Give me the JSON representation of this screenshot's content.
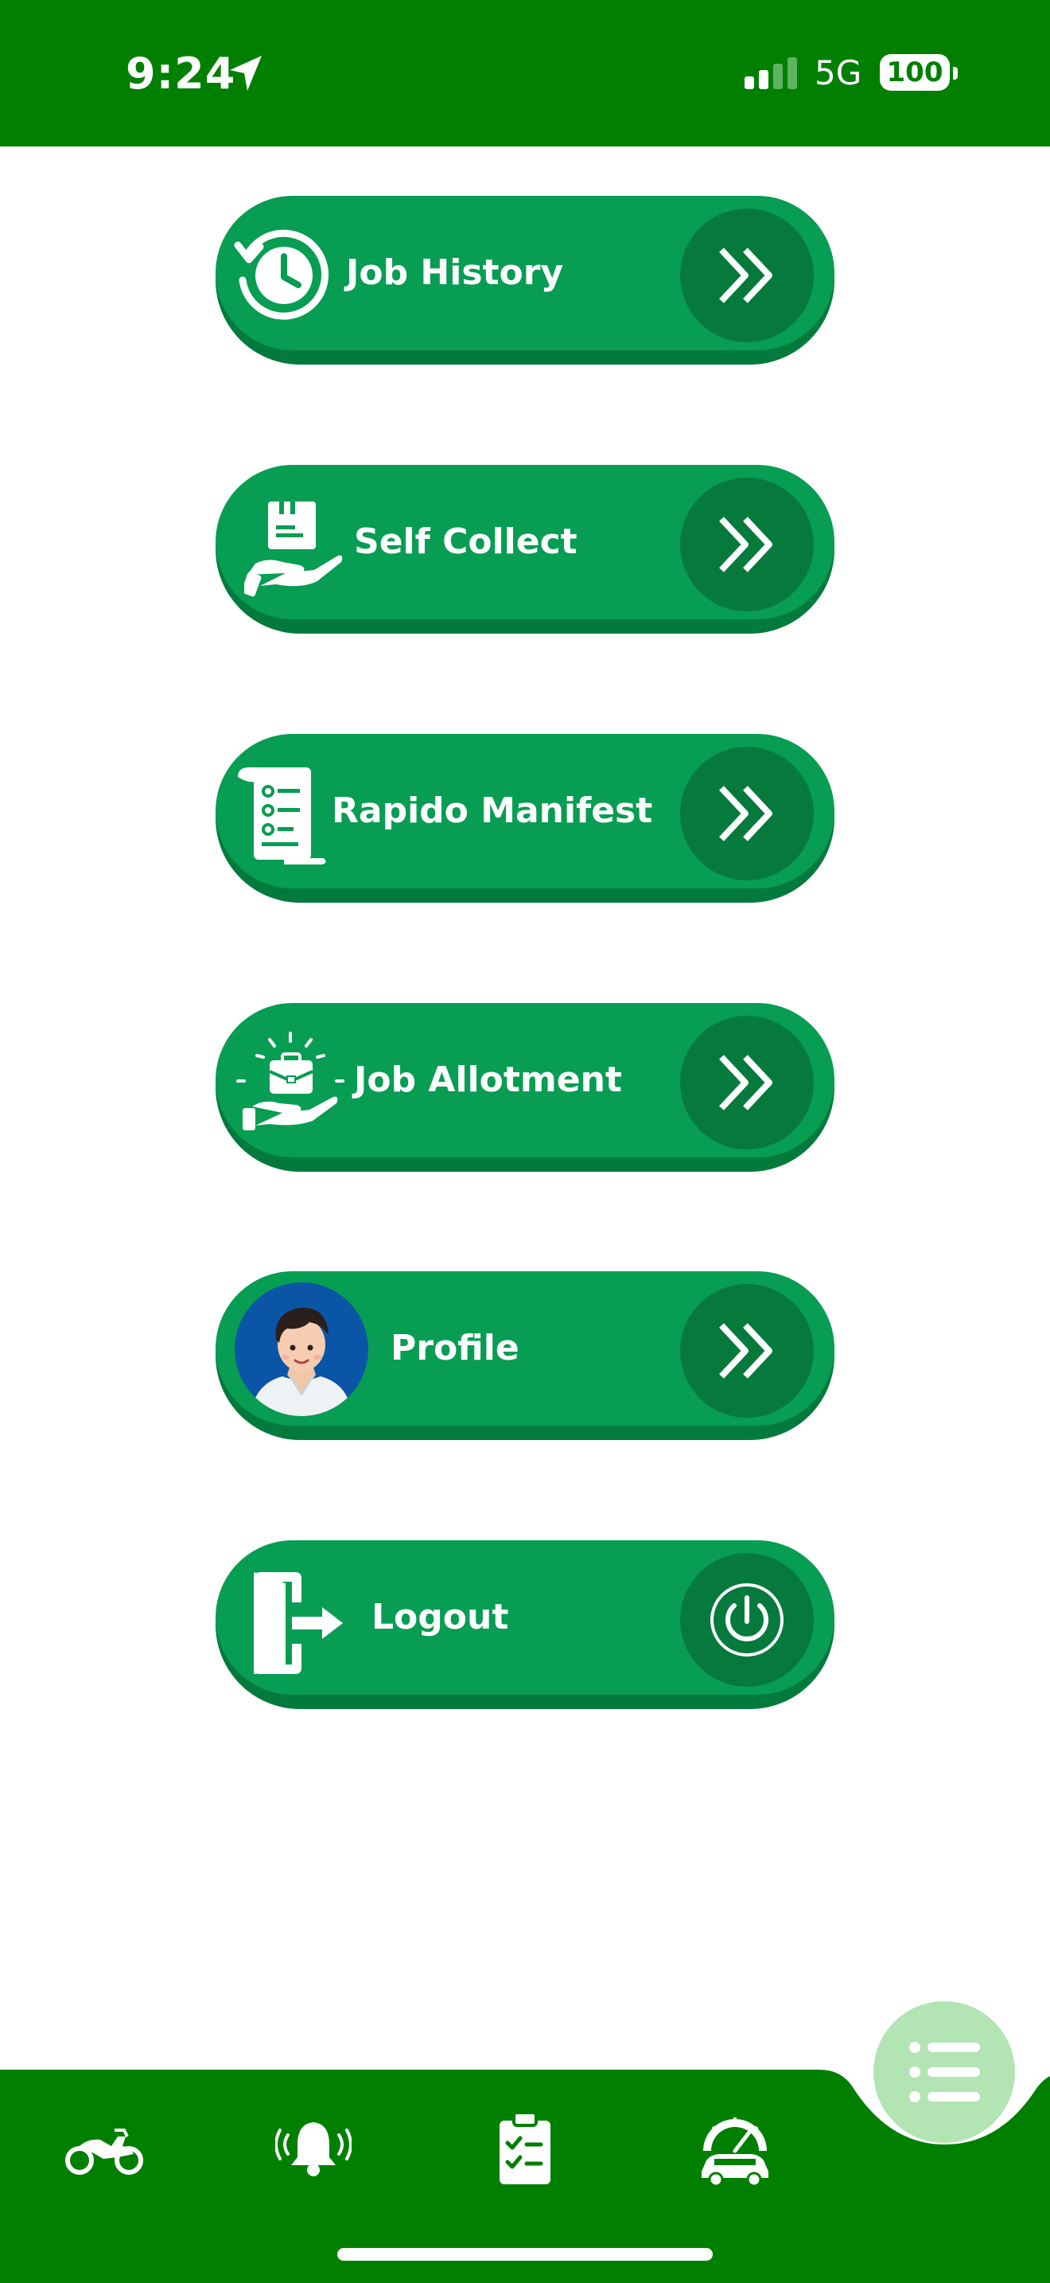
{
  "status_bar": {
    "time": "9:24",
    "network": "5G",
    "battery": "100",
    "icons": [
      "location-arrow-icon",
      "signal-bars-icon",
      "battery-icon"
    ]
  },
  "menu": {
    "items": [
      {
        "label": "Job History",
        "icon": "clock-history-icon",
        "action_icon": "double-chevron-right-icon"
      },
      {
        "label": "Self Collect",
        "icon": "hand-package-icon",
        "action_icon": "double-chevron-right-icon"
      },
      {
        "label": "Rapido Manifest",
        "icon": "scroll-list-icon",
        "action_icon": "double-chevron-right-icon"
      },
      {
        "label": "Job Allotment",
        "icon": "hand-briefcase-icon",
        "action_icon": "double-chevron-right-icon"
      },
      {
        "label": "Profile",
        "icon": "avatar",
        "action_icon": "double-chevron-right-icon"
      },
      {
        "label": "Logout",
        "icon": "exit-door-icon",
        "action_icon": "power-icon"
      }
    ]
  },
  "bottom_nav": {
    "items": [
      "motorbike-icon",
      "bell-ringing-icon",
      "clipboard-checklist-icon",
      "car-speedometer-icon"
    ],
    "fab_icon": "list-menu-icon"
  },
  "colors": {
    "status_bar": "#007f00",
    "button_face": "#079d52",
    "button_shadow": "#037a3d",
    "arrow_circle": "#067a3d",
    "fab": "#b3e4b3"
  }
}
